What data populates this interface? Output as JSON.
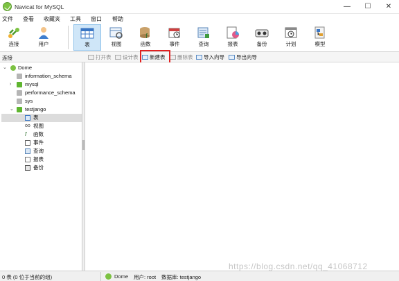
{
  "window": {
    "title": "Navicat for MySQL",
    "minimize": "—",
    "maximize": "☐",
    "close": "✕"
  },
  "menu": [
    "文件",
    "查看",
    "收藏夹",
    "工具",
    "窗口",
    "帮助"
  ],
  "toolbar": [
    {
      "label": "连接",
      "icon": "connection-icon"
    },
    {
      "label": "用户",
      "icon": "user-icon"
    },
    {
      "label": "表",
      "icon": "table-icon",
      "active": true
    },
    {
      "label": "视图",
      "icon": "view-icon"
    },
    {
      "label": "函数",
      "icon": "function-icon"
    },
    {
      "label": "事件",
      "icon": "event-icon"
    },
    {
      "label": "查询",
      "icon": "query-icon"
    },
    {
      "label": "报表",
      "icon": "report-icon"
    },
    {
      "label": "备份",
      "icon": "backup-icon"
    },
    {
      "label": "计划",
      "icon": "schedule-icon"
    },
    {
      "label": "模型",
      "icon": "model-icon"
    }
  ],
  "subbar": {
    "connection_label": "连接",
    "open_table": "打开表",
    "design_table": "设计表",
    "new_table": "新建表",
    "delete_table": "删除表",
    "import_wizard": "导入向导",
    "export_wizard": "导出向导"
  },
  "highlight_color": "#e02020",
  "tree": {
    "connection": "Dome",
    "databases": [
      "information_schema",
      "mysql",
      "performance_schema",
      "sys",
      "testjango"
    ],
    "children": [
      {
        "label": "表",
        "icon": "table-icon",
        "selected": true
      },
      {
        "label": "视图",
        "icon": "view-icon"
      },
      {
        "label": "函数",
        "icon": "function-icon"
      },
      {
        "label": "事件",
        "icon": "event-icon"
      },
      {
        "label": "查询",
        "icon": "query-icon"
      },
      {
        "label": "报表",
        "icon": "report-icon"
      },
      {
        "label": "备份",
        "icon": "backup-icon"
      }
    ]
  },
  "status": {
    "left": "0 表 (0 位于当前的组)",
    "connection": "Dome",
    "user": "用户: root",
    "database": "数据库: testjango"
  },
  "watermark": "https://blog.csdn.net/qq_41068712"
}
